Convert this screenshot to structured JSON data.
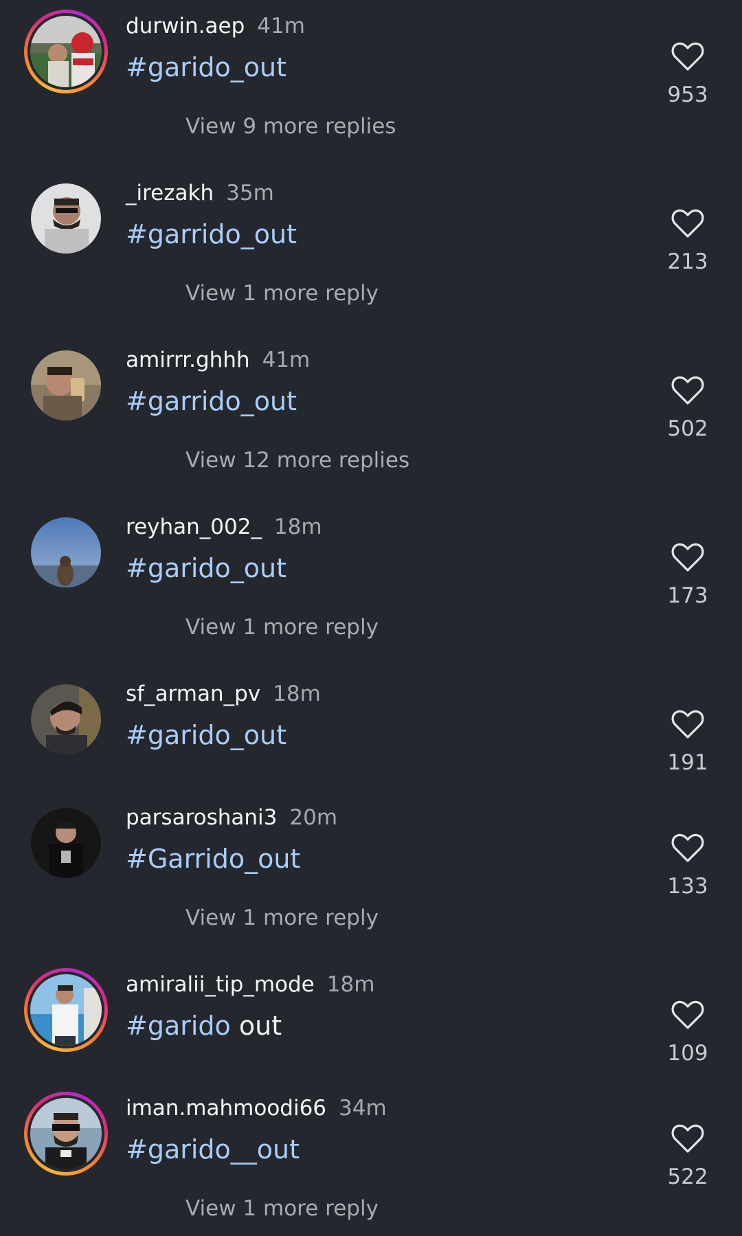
{
  "comments": [
    {
      "username": "durwin.aep",
      "time": "41m",
      "hashtag": "#garido_out",
      "rest": "",
      "replies": "View 9 more replies",
      "likes": "953",
      "avatar": "spiderman-photo",
      "story": true
    },
    {
      "username": "_irezakh",
      "time": "35m",
      "hashtag": "#garrido_out",
      "rest": "",
      "replies": "View 1 more reply",
      "likes": "213",
      "avatar": "man-sunglasses-photo",
      "story": false
    },
    {
      "username": "amirrr.ghhh",
      "time": "41m",
      "hashtag": "#garrido_out",
      "rest": "",
      "replies": "View 12 more replies",
      "likes": "502",
      "avatar": "man-selfie-photo",
      "story": false
    },
    {
      "username": "reyhan_002_",
      "time": "18m",
      "hashtag": "#garido_out",
      "rest": "",
      "replies": "View 1 more reply",
      "likes": "173",
      "avatar": "woman-sea-photo",
      "story": false
    },
    {
      "username": "sf_arman_pv",
      "time": "18m",
      "hashtag": "#garido_out",
      "rest": "",
      "replies": "",
      "likes": "191",
      "avatar": "man-profile-photo",
      "story": false
    },
    {
      "username": "parsaroshani3",
      "time": "20m",
      "hashtag": "#Garrido_out",
      "rest": "",
      "replies": "View 1 more reply",
      "likes": "133",
      "avatar": "man-dark-photo",
      "story": false
    },
    {
      "username": "amiralii_tip_mode",
      "time": "18m",
      "hashtag": "#garido",
      "rest": "out",
      "replies": "",
      "likes": "109",
      "avatar": "man-beach-photo",
      "story": true
    },
    {
      "username": "iman.mahmoodi66",
      "time": "34m",
      "hashtag": "#garido__out",
      "rest": "",
      "replies": "View 1 more reply",
      "likes": "522",
      "avatar": "man-crowd-photo",
      "story": true
    }
  ],
  "colors": {
    "background": "#25272e",
    "hashtag": "#a9cdf9",
    "muted": "#a7a9ae"
  },
  "icons": {
    "like": "heart-outline-icon"
  }
}
